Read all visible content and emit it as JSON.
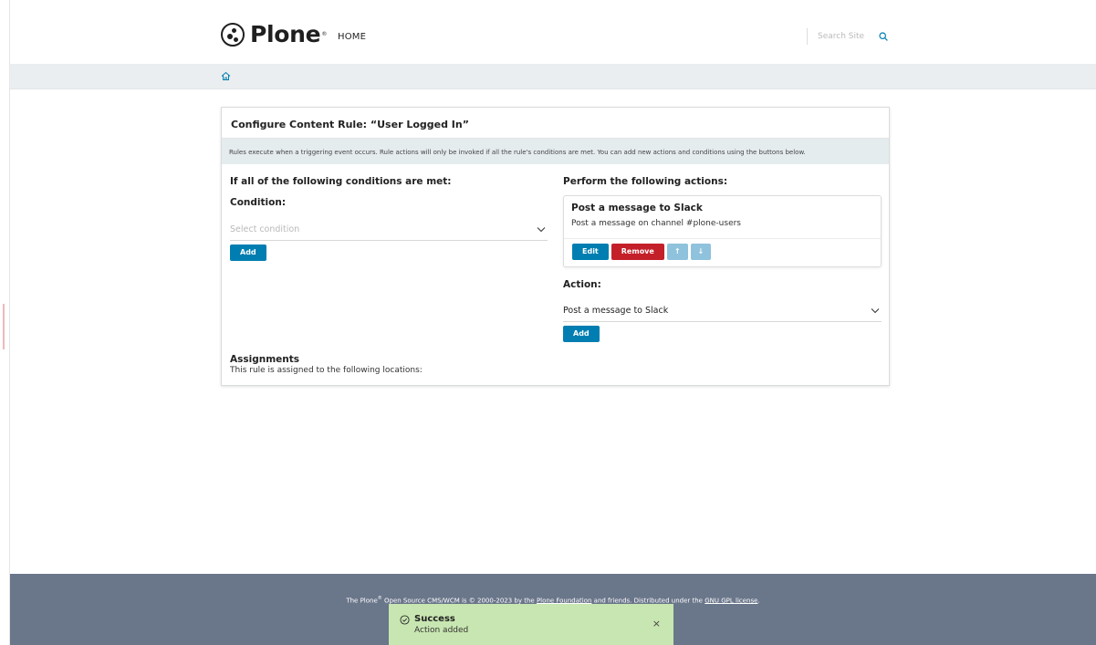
{
  "header": {
    "logo_text": "Plone",
    "logo_reg": "®",
    "nav_home": "HOME",
    "search_placeholder": "Search Site"
  },
  "card": {
    "title": "Configure Content Rule: “User Logged In”",
    "info": "Rules execute when a triggering event occurs. Rule actions will only be invoked if all the rule's conditions are met. You can add new actions and conditions using the buttons below.",
    "conditions": {
      "heading": "If all of the following conditions are met:",
      "condition_label": "Condition:",
      "select_placeholder": "Select condition",
      "add_label": "Add"
    },
    "actions": {
      "heading": "Perform the following actions:",
      "items": [
        {
          "title": "Post a message to Slack",
          "description": "Post a message on channel #plone-users",
          "edit_label": "Edit",
          "remove_label": "Remove",
          "up_label": "↑",
          "down_label": "↓"
        }
      ],
      "action_label": "Action:",
      "select_value": "Post a message to Slack",
      "add_label": "Add"
    },
    "assignments": {
      "title": "Assignments",
      "text": "This rule is assigned to the following locations:"
    }
  },
  "footer": {
    "prefix": "The Plone",
    "reg": "®",
    "part1": " Open Source CMS/WCM is © 2000-2023 by the ",
    "foundation_link": "Plone Foundation",
    "part2": " and friends. Distributed under the ",
    "license_link": "GNU GPL license",
    "part3": "."
  },
  "toast": {
    "title": "Success",
    "message": "Action added",
    "close": "×"
  },
  "colors": {
    "primary": "#007eb1",
    "danger": "#c4202a",
    "footer": "#6a768a",
    "success_bg": "#c8e6b1"
  }
}
